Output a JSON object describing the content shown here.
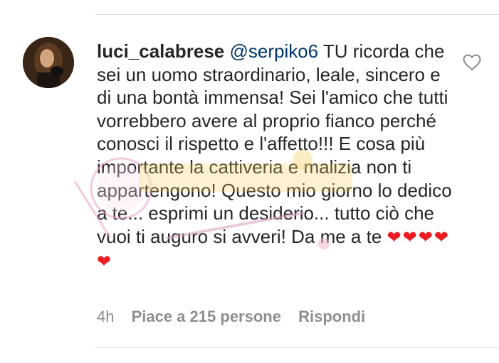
{
  "comment": {
    "username": "luci_calabrese",
    "mention": "@serpiko6",
    "text": "TU ricorda che sei un uomo straordinario, leale, sincero e di una bontà immensa! Sei l'amico che tutti vorrebbero avere al proprio fianco perché conosci il rispetto e l'affetto!!! E cosa più importante la cattiveria e malizia non ti appartengono! Questo mio giorno lo dedico a te... esprimi un desiderio... tutto ciò che vuoi ti auguro si avveri! Da me a te",
    "hearts": "❤❤❤❤❤"
  },
  "meta": {
    "time": "4h",
    "likes": "Piace a 215 persone",
    "reply": "Rispondi"
  },
  "icons": {
    "like": "heart-outline-icon",
    "avatar": "user-avatar"
  },
  "colors": {
    "text": "#262626",
    "mention": "#00376b",
    "muted": "#8e8e8e",
    "heart": "#ed1c24",
    "divider": "#dbdbdb"
  }
}
